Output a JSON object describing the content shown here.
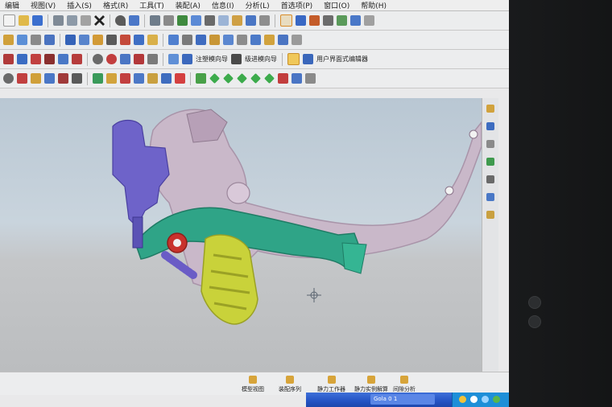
{
  "menubar": {
    "items": [
      "编辑",
      "视图(V)",
      "插入(S)",
      "格式(R)",
      "工具(T)",
      "装配(A)",
      "信息(I)",
      "分析(L)",
      "首选项(P)",
      "窗口(O)",
      "帮助(H)"
    ]
  },
  "toolbar3": {
    "label_a": "注塑模向导",
    "label_b": "级进模向导",
    "label_c": "用户界面式编辑器"
  },
  "statusbar": {
    "items": [
      "模型视图",
      "装配序列",
      "静力工作器",
      "静力实例解算",
      "间隙分析"
    ]
  },
  "taskbar": {
    "task_label": "Gola 0 1"
  },
  "colors": {
    "frame": "#c9b8c9",
    "pedal_arm": "#2fa487",
    "footpeg": "#c9d23a",
    "master_cylinder": "#6e63c9",
    "spring": "#6a5cc6",
    "pivot": "#c8322c",
    "background_top": "#b9c7d3",
    "background_bottom": "#b9bbbd"
  },
  "icons": [
    "new-file-icon",
    "open-icon",
    "save-icon",
    "cut-icon",
    "copy-icon",
    "paste-icon",
    "delete-icon",
    "undo-icon",
    "zoom-icon",
    "rotate-icon",
    "pan-icon",
    "fit-icon",
    "render-icon",
    "snap-icon",
    "crosshair-icon"
  ]
}
